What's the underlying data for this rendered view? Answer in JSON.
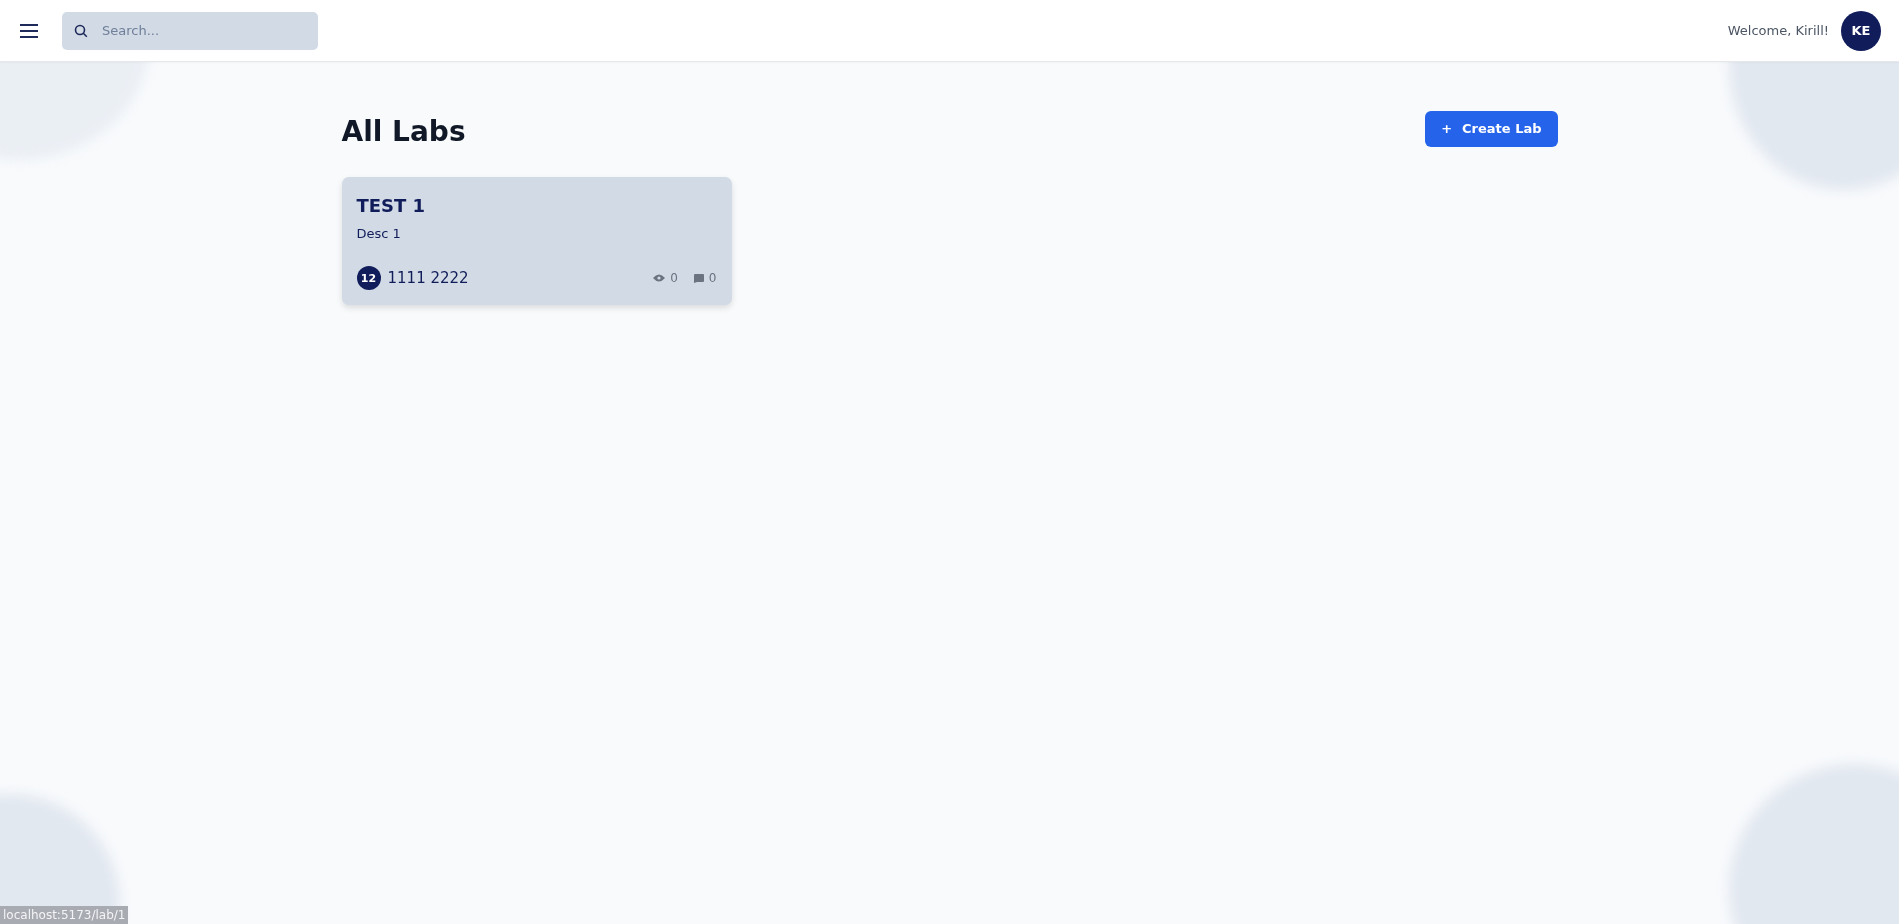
{
  "header": {
    "search": {
      "placeholder": "Search..."
    },
    "welcome": "Welcome, Kirill!",
    "avatar": "KE"
  },
  "page": {
    "title": "All Labs",
    "create_button": {
      "icon": "+",
      "label": "Create Lab"
    }
  },
  "labs": [
    {
      "title": "TEST 1",
      "description": "Desc 1",
      "badge": "12",
      "author": "1111 2222",
      "views": "0",
      "comments": "0"
    }
  ],
  "status_link": "localhost:5173/lab/1"
}
